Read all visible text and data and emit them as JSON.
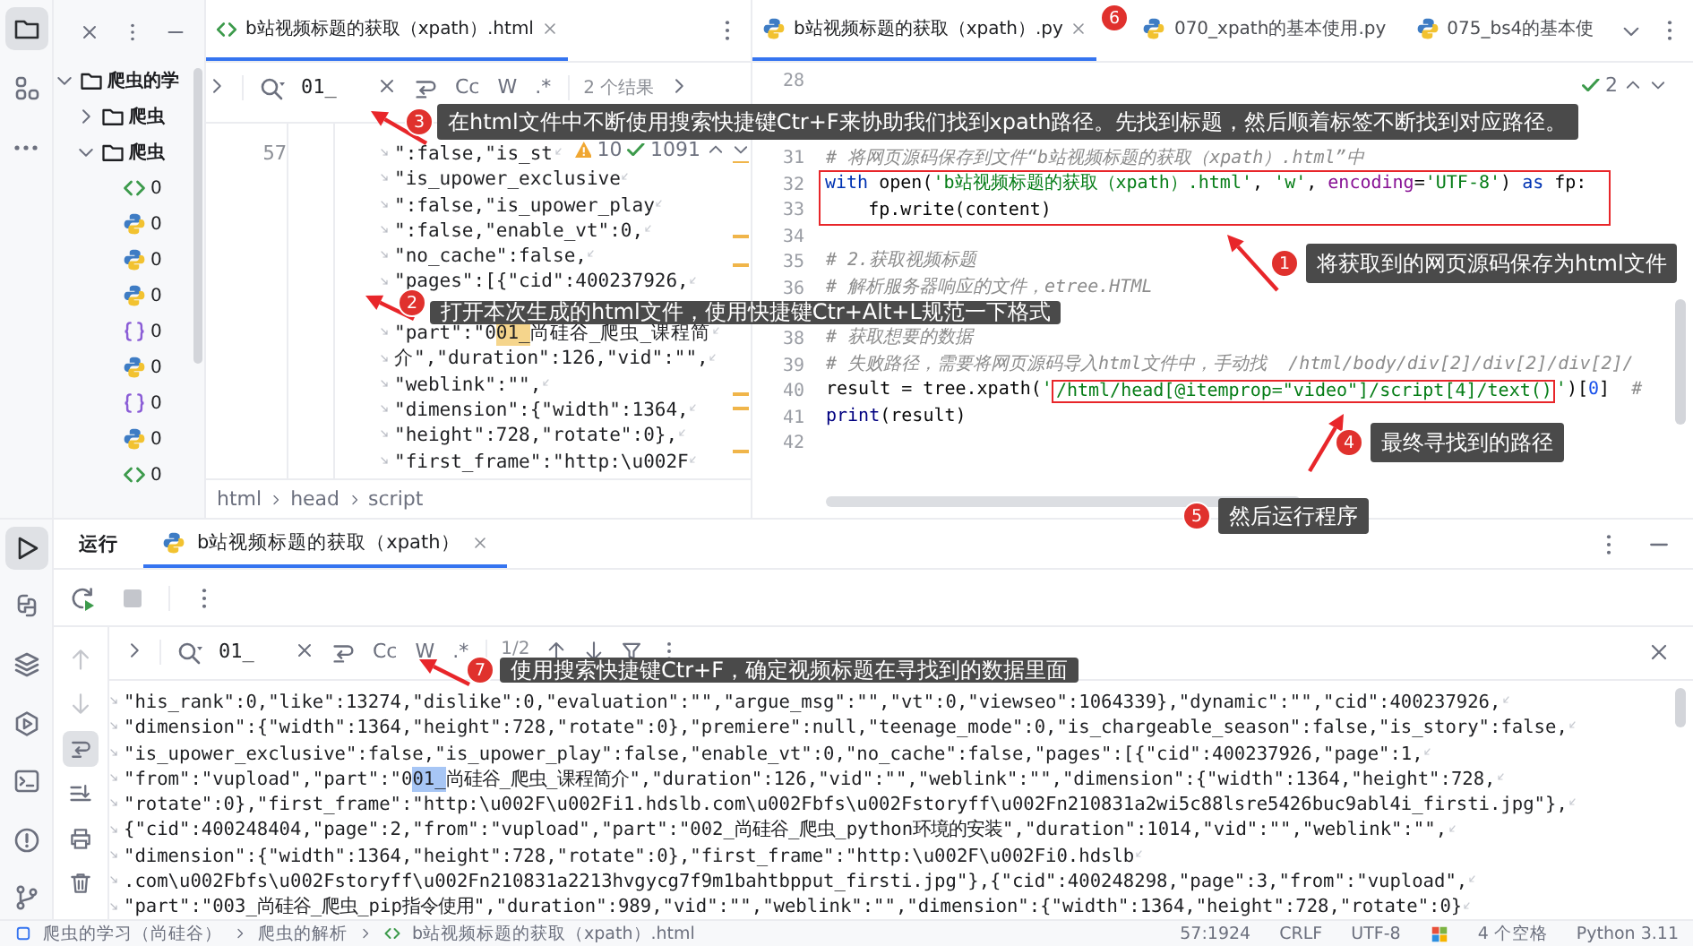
{
  "activity_bar": {
    "top": [
      {
        "kind": "folder",
        "selected": true
      },
      {
        "kind": "structure",
        "selected": false
      },
      {
        "kind": "more",
        "selected": false
      }
    ],
    "bottom": [
      {
        "kind": "run",
        "selected": true
      },
      {
        "kind": "python",
        "selected": false
      },
      {
        "kind": "layers",
        "selected": false
      },
      {
        "kind": "services",
        "selected": false
      },
      {
        "kind": "terminal",
        "selected": false
      },
      {
        "kind": "problems",
        "selected": false
      },
      {
        "kind": "git",
        "selected": false
      }
    ]
  },
  "project_panel": {
    "tree": [
      {
        "kind": "folder",
        "label": "爬虫的学",
        "expanded": true,
        "children": [
          {
            "kind": "folder",
            "label": "爬虫",
            "expanded": false
          },
          {
            "kind": "folder",
            "label": "爬虫",
            "expanded": true,
            "children": [
              {
                "kind": "html",
                "label": "0"
              },
              {
                "kind": "py",
                "label": "0"
              },
              {
                "kind": "py",
                "label": "0"
              },
              {
                "kind": "py",
                "label": "0"
              },
              {
                "kind": "json",
                "label": "0"
              },
              {
                "kind": "py",
                "label": "0"
              },
              {
                "kind": "json",
                "label": "0"
              },
              {
                "kind": "py",
                "label": "0"
              },
              {
                "kind": "html",
                "label": "0"
              }
            ]
          }
        ]
      }
    ]
  },
  "left_editor": {
    "tab": {
      "label": "b站视频标题的获取（xpath）.html",
      "selected": true
    },
    "search": {
      "value": "01_",
      "options": [
        "Cc",
        "W",
        ".*"
      ],
      "result_count": "2 个结果"
    },
    "line_number": "57",
    "inspections": {
      "warnings": "10",
      "passed": "1091"
    },
    "rows": [
      {
        "text": "\":false,\"is_st"
      },
      {
        "text": "\"is_upower_exclusive"
      },
      {
        "text": "\":false,\"is_upower_play"
      },
      {
        "text": "\":false,\"enable_vt\":0,"
      },
      {
        "text": "\"no_cache\":false,"
      },
      {
        "text": "\"pages\":[{\"cid\":400237926,"
      },
      {
        "gap_before": true,
        "text": "\"part\":\"0",
        "match": "01_",
        "rest": "尚硅谷_爬虫_课程简"
      },
      {
        "text": "介\",\"duration\":126,\"vid\":\"\","
      },
      {
        "text": "\"weblink\":\"\","
      },
      {
        "text": "\"dimension\":{\"width\":1364,"
      },
      {
        "text": "\"height\":728,\"rotate\":0},"
      },
      {
        "text": "\"first_frame\":\"http:\\u002F"
      }
    ],
    "breadcrumbs": [
      "html",
      "head",
      "script"
    ]
  },
  "right_editor": {
    "tabs": [
      {
        "label": "b站视频标题的获取（xpath）.py",
        "selected": true,
        "closable": true
      },
      {
        "label": "070_xpath的基本使用.py",
        "selected": false,
        "closable": false
      },
      {
        "label": "075_bs4的基本使",
        "selected": false,
        "closable": false
      }
    ],
    "inspections": {
      "passed": "2"
    },
    "lines": [
      {
        "number": "28"
      },
      {
        "number": "31",
        "tokens": [
          {
            "kind": "comment",
            "text": "# 将网页源码保存到文件“b站视频标题的获取（xpath）.html”中"
          }
        ]
      },
      {
        "number": "32",
        "framed": true,
        "tokens": [
          {
            "kind": "keyword",
            "text": "with"
          },
          {
            "kind": "plain",
            "text": " open("
          },
          {
            "kind": "string",
            "text": "'b站视频标题的获取（xpath）.html'"
          },
          {
            "kind": "plain",
            "text": ", "
          },
          {
            "kind": "string",
            "text": "'w'"
          },
          {
            "kind": "plain",
            "text": ", "
          },
          {
            "kind": "param",
            "text": "encoding"
          },
          {
            "kind": "plain",
            "text": "="
          },
          {
            "kind": "string",
            "text": "'UTF-8'"
          },
          {
            "kind": "plain",
            "text": ") "
          },
          {
            "kind": "keyword",
            "text": "as"
          },
          {
            "kind": "plain",
            "text": " fp:"
          }
        ]
      },
      {
        "number": "33",
        "framed": true,
        "tokens": [
          {
            "kind": "plain",
            "text": "    fp.write(content)"
          }
        ]
      },
      {
        "number": "34"
      },
      {
        "number": "35",
        "tokens": [
          {
            "kind": "comment",
            "text": "# 2.获取视频标题"
          }
        ]
      },
      {
        "number": "36",
        "tokens": [
          {
            "kind": "comment",
            "text": "# 解析服务器响应的文件，etree.HTML"
          }
        ]
      },
      {
        "number": "38",
        "tokens": [
          {
            "kind": "comment",
            "text": "# 获取想要的数据"
          }
        ]
      },
      {
        "number": "39",
        "tokens": [
          {
            "kind": "comment",
            "text": "# 失败路径，需要将网页源码导入html文件中，手动找  /html/body/div[2]/div[2]/div[2]/"
          }
        ]
      },
      {
        "number": "40",
        "tokens": [
          {
            "kind": "plain",
            "text": "result = tree.xpath("
          },
          {
            "kind": "string",
            "text": "'"
          },
          {
            "kind": "string",
            "text": "/html/head[@itemprop=\"video\"]/script[4]/text()",
            "framed": true
          },
          {
            "kind": "string",
            "text": "'"
          },
          {
            "kind": "plain",
            "text": ")["
          },
          {
            "kind": "number",
            "text": "0"
          },
          {
            "kind": "plain",
            "text": "]"
          },
          {
            "kind": "comment",
            "text": "  #"
          }
        ]
      },
      {
        "number": "41",
        "tokens": [
          {
            "kind": "builtin",
            "text": "print"
          },
          {
            "kind": "plain",
            "text": "(result)"
          }
        ]
      },
      {
        "number": "42"
      }
    ]
  },
  "run_panel": {
    "title": "运行",
    "tab": {
      "label": "b站视频标题的获取（xpath）",
      "selected": true
    },
    "side_tools": [
      {
        "kind": "up",
        "disabled": true,
        "selected": false
      },
      {
        "kind": "down",
        "disabled": true,
        "selected": false
      },
      {
        "kind": "wrap",
        "disabled": false,
        "selected": true
      },
      {
        "kind": "scroll_end",
        "disabled": false,
        "selected": false
      },
      {
        "kind": "print",
        "disabled": false,
        "selected": false
      },
      {
        "kind": "trash",
        "disabled": false,
        "selected": false
      }
    ],
    "search": {
      "value": "01_",
      "options": [
        "Cc",
        "W",
        ".*"
      ],
      "result_count": "1/2"
    },
    "output": [
      {
        "text": "\"his_rank\":0,\"like\":13274,\"dislike\":0,\"evaluation\":\"\",\"argue_msg\":\"\",\"vt\":0,\"viewseo\":1064339},\"dynamic\":\"\",\"cid\":400237926,"
      },
      {
        "text": "\"dimension\":{\"width\":1364,\"height\":728,\"rotate\":0},\"premiere\":null,\"teenage_mode\":0,\"is_chargeable_season\":false,\"is_story\":false,"
      },
      {
        "text": "\"is_upower_exclusive\":false,\"is_upower_play\":false,\"enable_vt\":0,\"no_cache\":false,\"pages\":[{\"cid\":400237926,\"page\":1,"
      },
      {
        "text": "\"from\":\"vupload\",\"part\":\"0",
        "match": "01_",
        "rest": "尚硅谷_爬虫_课程简介\",\"duration\":126,\"vid\":\"\",\"weblink\":\"\",\"dimension\":{\"width\":1364,\"height\":728,"
      },
      {
        "text": "\"rotate\":0},\"first_frame\":\"http:\\u002F\\u002Fi1.hdslb.com\\u002Fbfs\\u002Fstoryff\\u002Fn210831a2wi5c88lsre5426buc9abl4i_firsti.jpg\"},"
      },
      {
        "text": "{\"cid\":400248404,\"page\":2,\"from\":\"vupload\",\"part\":\"002_尚硅谷_爬虫_python环境的安装\",\"duration\":1014,\"vid\":\"\",\"weblink\":\"\","
      },
      {
        "text": "\"dimension\":{\"width\":1364,\"height\":728,\"rotate\":0},\"first_frame\":\"http:\\u002F\\u002Fi0.hdslb"
      },
      {
        "text": ".com\\u002Fbfs\\u002Fstoryff\\u002Fn210831a2213hvgycg7f9m1bahtbpput_firsti.jpg\"},{\"cid\":400248298,\"page\":3,\"from\":\"vupload\","
      },
      {
        "text": "\"part\":\"003_尚硅谷_爬虫_pip指令使用\",\"duration\":989,\"vid\":\"\",\"weblink\":\"\",\"dimension\":{\"width\":1364,\"height\":728,\"rotate\":0}"
      }
    ]
  },
  "status_bar": {
    "breadcrumbs": [
      {
        "kind": "module",
        "label": "爬虫的学习（尚硅谷）"
      },
      {
        "kind": "plain",
        "label": "爬虫的解析"
      },
      {
        "kind": "html",
        "label": "b站视频标题的获取（xpath）.html"
      }
    ],
    "items": [
      {
        "kind": "text",
        "text": "57:1924"
      },
      {
        "kind": "text",
        "text": "CRLF"
      },
      {
        "kind": "text",
        "text": "UTF-8"
      },
      {
        "kind": "os"
      },
      {
        "kind": "text",
        "text": "4 个空格"
      },
      {
        "kind": "text",
        "text": "Python 3.11"
      }
    ]
  },
  "callouts": [
    {
      "number": "6"
    },
    {
      "number": "3",
      "text": "在html文件中不断使用搜索快捷键Ctr+F来协助我们找到xpath路径。先找到标题，然后顺着标签不断找到对应路径。"
    },
    {
      "number": "1",
      "text": "将获取到的网页源码保存为html文件"
    },
    {
      "number": "2",
      "text": "打开本次生成的html文件，使用快捷键Ctr+Alt+L规范一下格式"
    },
    {
      "number": "4",
      "text": "最终寻找到的路径"
    },
    {
      "number": "5",
      "text": "然后运行程序"
    },
    {
      "number": "7",
      "text": "使用搜索快捷键Ctr+F，确定视频标题在寻找到的数据里面"
    }
  ]
}
